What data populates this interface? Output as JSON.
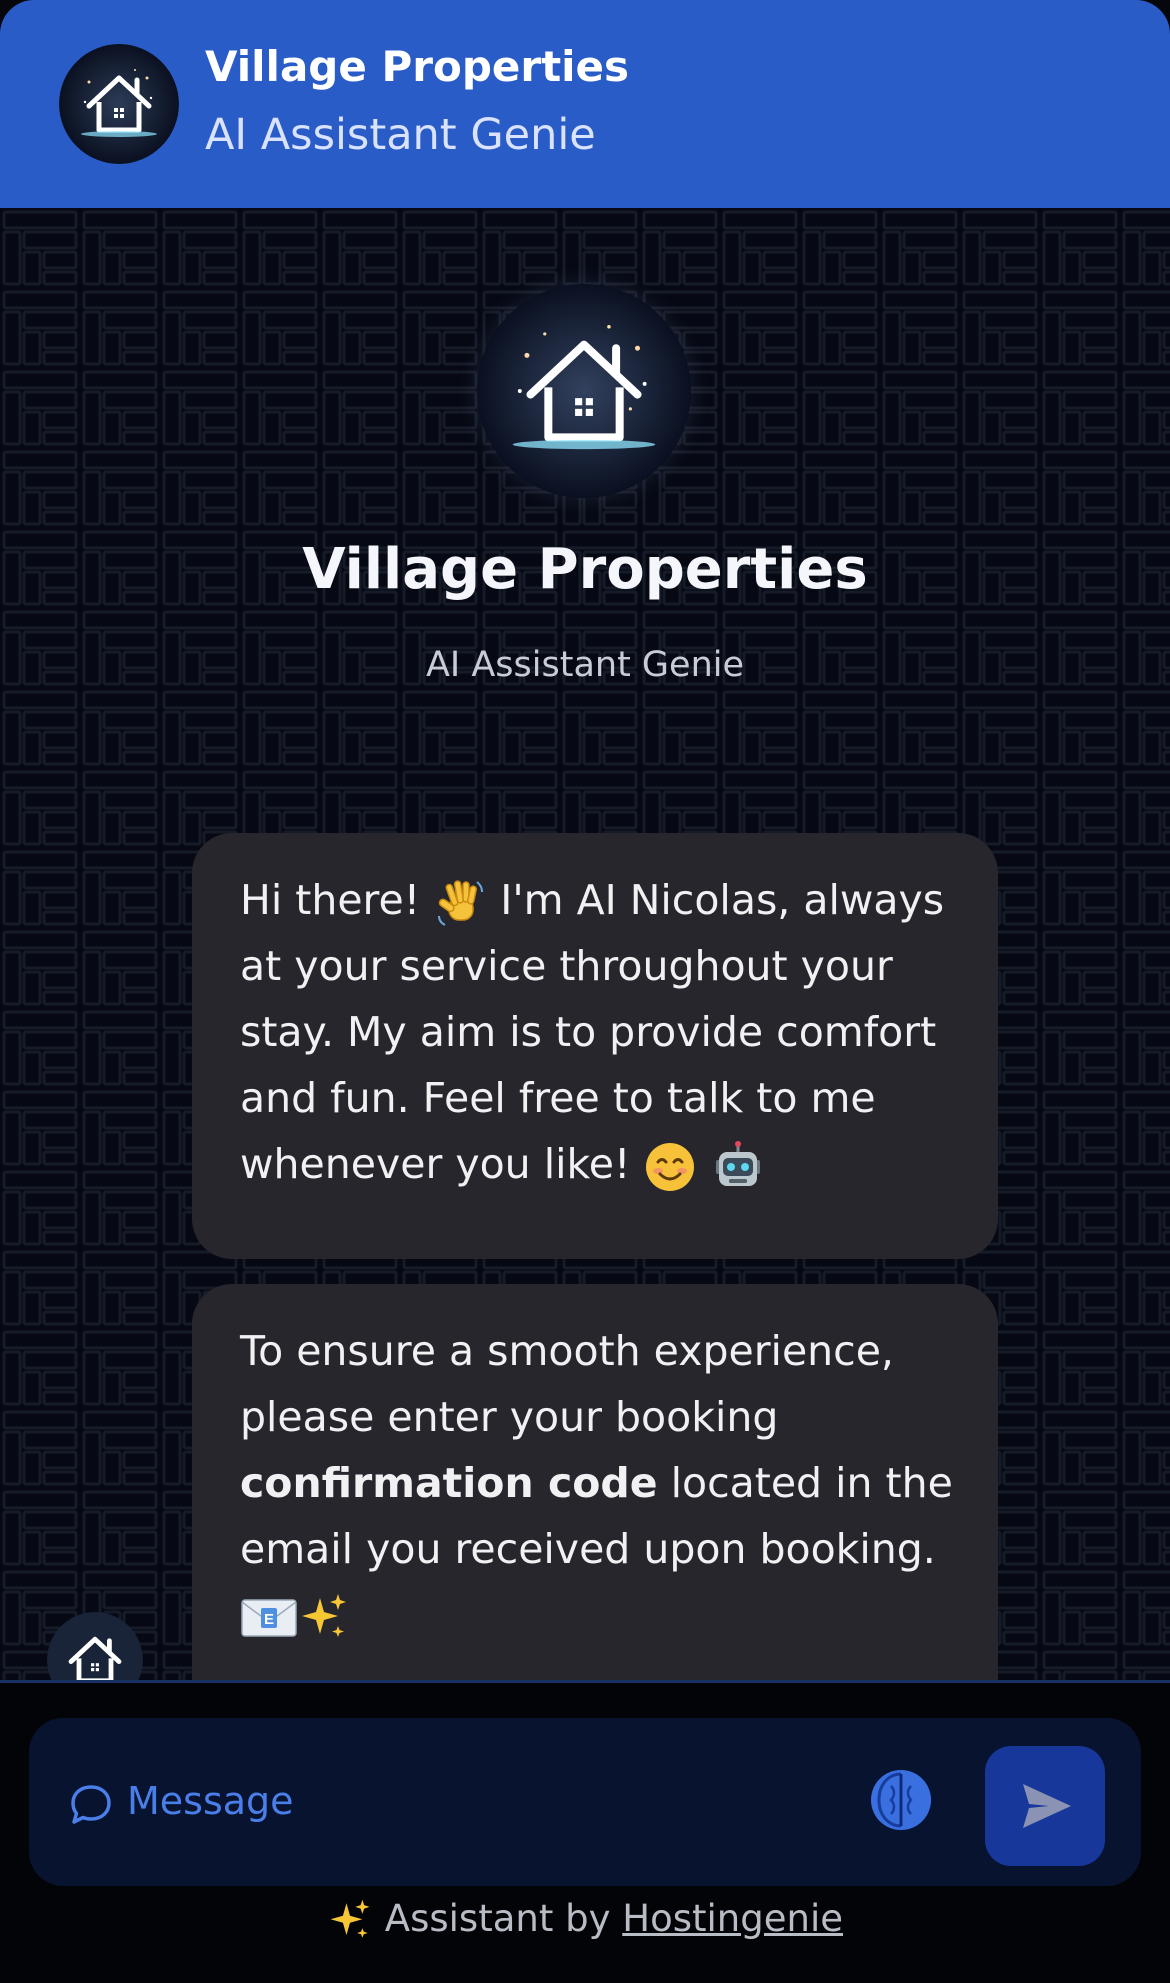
{
  "header": {
    "title": "Village Properties",
    "subtitle": "AI Assistant Genie",
    "avatar_icon": "house-logo-icon"
  },
  "hero": {
    "title": "Village Properties",
    "subtitle": "AI Assistant Genie",
    "avatar_icon": "house-logo-icon"
  },
  "messages": [
    {
      "sender": "assistant",
      "text_before_wave": "Hi there! ",
      "text_after_wave": " I'm AI Nicolas, always at your service throughout your stay. My aim is to provide comfort and fun. Feel free to talk to me whenever you like! ",
      "emoji": [
        "waving-hand-icon",
        "smiling-face-icon",
        "robot-face-icon"
      ]
    },
    {
      "sender": "assistant",
      "text_before_bold": "To ensure a smooth experience, please enter your booking ",
      "bold": "confirmation code",
      "text_after_bold": " located in the email you received upon booking.",
      "emoji": [
        "envelope-icon",
        "sparkles-icon"
      ]
    }
  ],
  "input": {
    "placeholder": "Message",
    "icon": "chat-bubble-icon"
  },
  "buttons": {
    "voice_icon": "brain-icon",
    "send_icon": "send-arrow-icon"
  },
  "footer": {
    "prefix": "Assistant by",
    "link": "Hostingenie",
    "icon": "sparkles-icon"
  },
  "colors": {
    "header_bg": "#2a5cc7",
    "chat_bg": "#060913",
    "bubble_bg": "#26262c",
    "input_bg": "#07132f",
    "accent": "#4a7ee8",
    "send_bg": "#17379a"
  }
}
